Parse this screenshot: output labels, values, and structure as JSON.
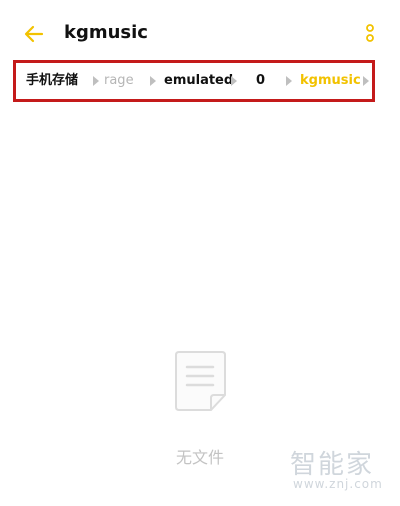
{
  "header": {
    "title": "kgmusic",
    "back_icon": "arrow-left-icon",
    "more_icon": "more-vertical-icon",
    "accent_color": "#f2c200"
  },
  "breadcrumb": {
    "items": [
      {
        "label": "手机存储"
      },
      {
        "label": "rage"
      },
      {
        "label": "emulated"
      },
      {
        "label": "0"
      },
      {
        "label": "kgmusic"
      }
    ],
    "highlight_color": "#c41a1a"
  },
  "empty_state": {
    "icon": "document-icon",
    "text": "无文件"
  },
  "watermark": {
    "title": "智能家",
    "url": "www.znj.com"
  }
}
